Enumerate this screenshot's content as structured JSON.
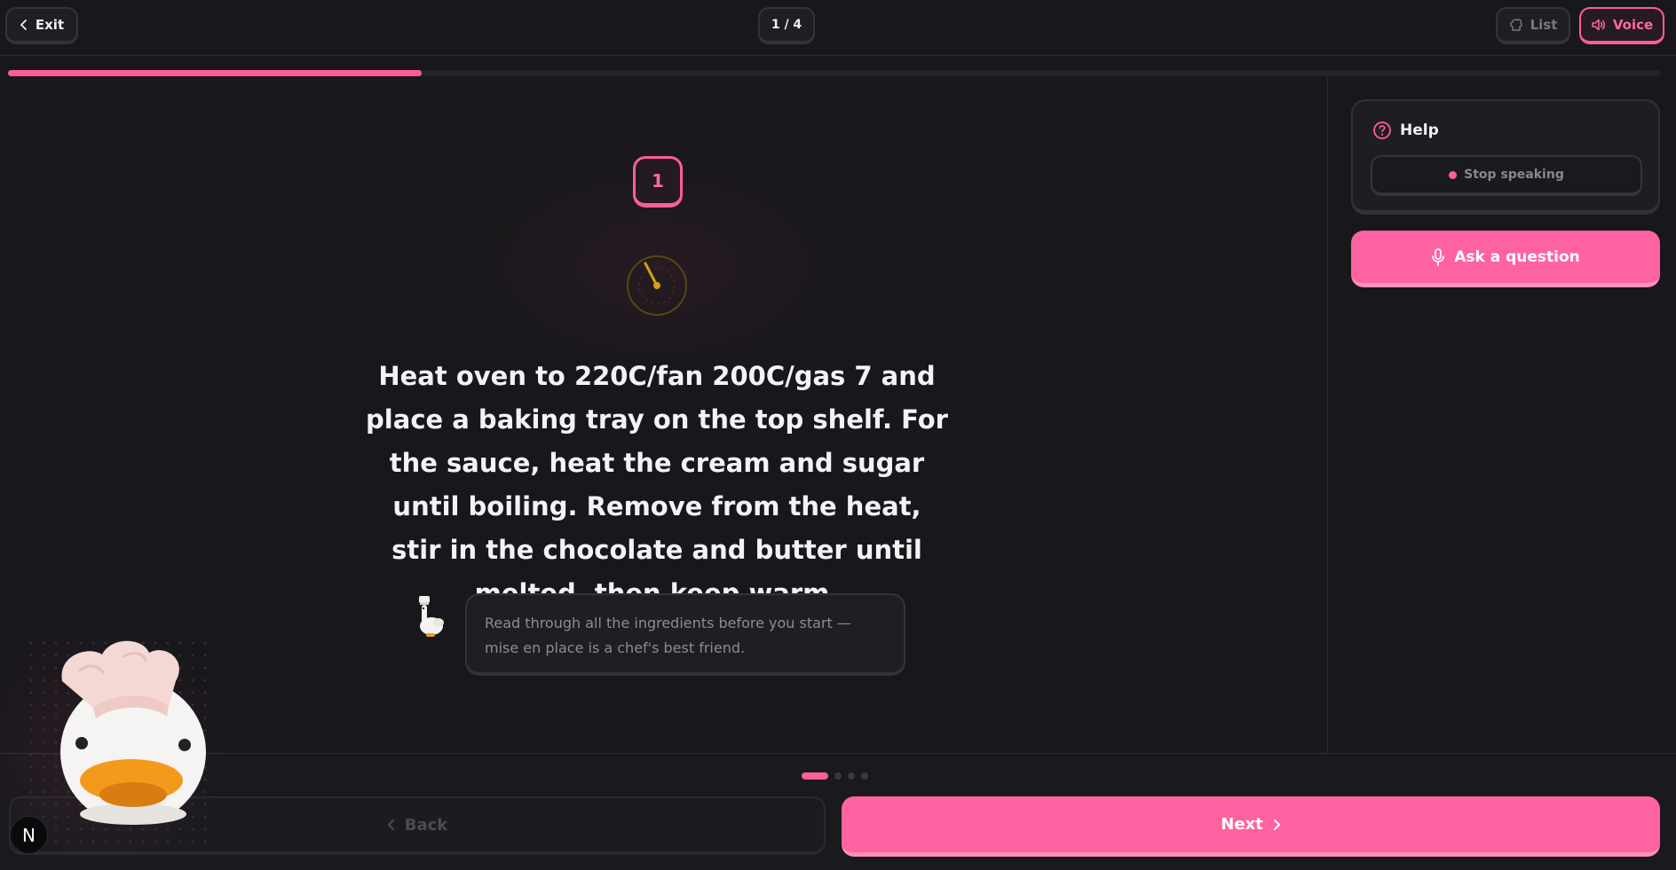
{
  "header": {
    "exit_label": "Exit",
    "step_counter": "1 / 4",
    "list_label": "List",
    "voice_label": "Voice"
  },
  "progress": {
    "value": 0.25,
    "color": "#ff5c9a"
  },
  "step": {
    "number": "1",
    "instruction": "Heat oven to 220C/fan 200C/gas 7 and place a baking tray on the top shelf. For the sauce, heat the cream and sugar until boiling. Remove from the heat, stir in the chocolate and butter until melted, then keep warm.",
    "tip": "Read through all the ingredients before you start — mise en place is a chef's best friend."
  },
  "sidebar": {
    "help_title": "Help",
    "stop_speaking_label": "Stop speaking",
    "ask_question_label": "Ask a question"
  },
  "footer": {
    "back_label": "Back",
    "next_label": "Next",
    "total_steps": 4,
    "current_step": 1
  },
  "dev_badge": "N",
  "colors": {
    "accent": "#ff62a1",
    "background": "#18171b",
    "timer": "#d4a017"
  },
  "icons": {
    "exit": "chevron-left-icon",
    "list": "chef-hat-icon",
    "voice": "speaker-icon",
    "timer": "timer-icon",
    "help": "question-circle-icon",
    "ask": "microphone-icon",
    "back": "chevron-left-icon",
    "next": "chevron-right-icon"
  }
}
